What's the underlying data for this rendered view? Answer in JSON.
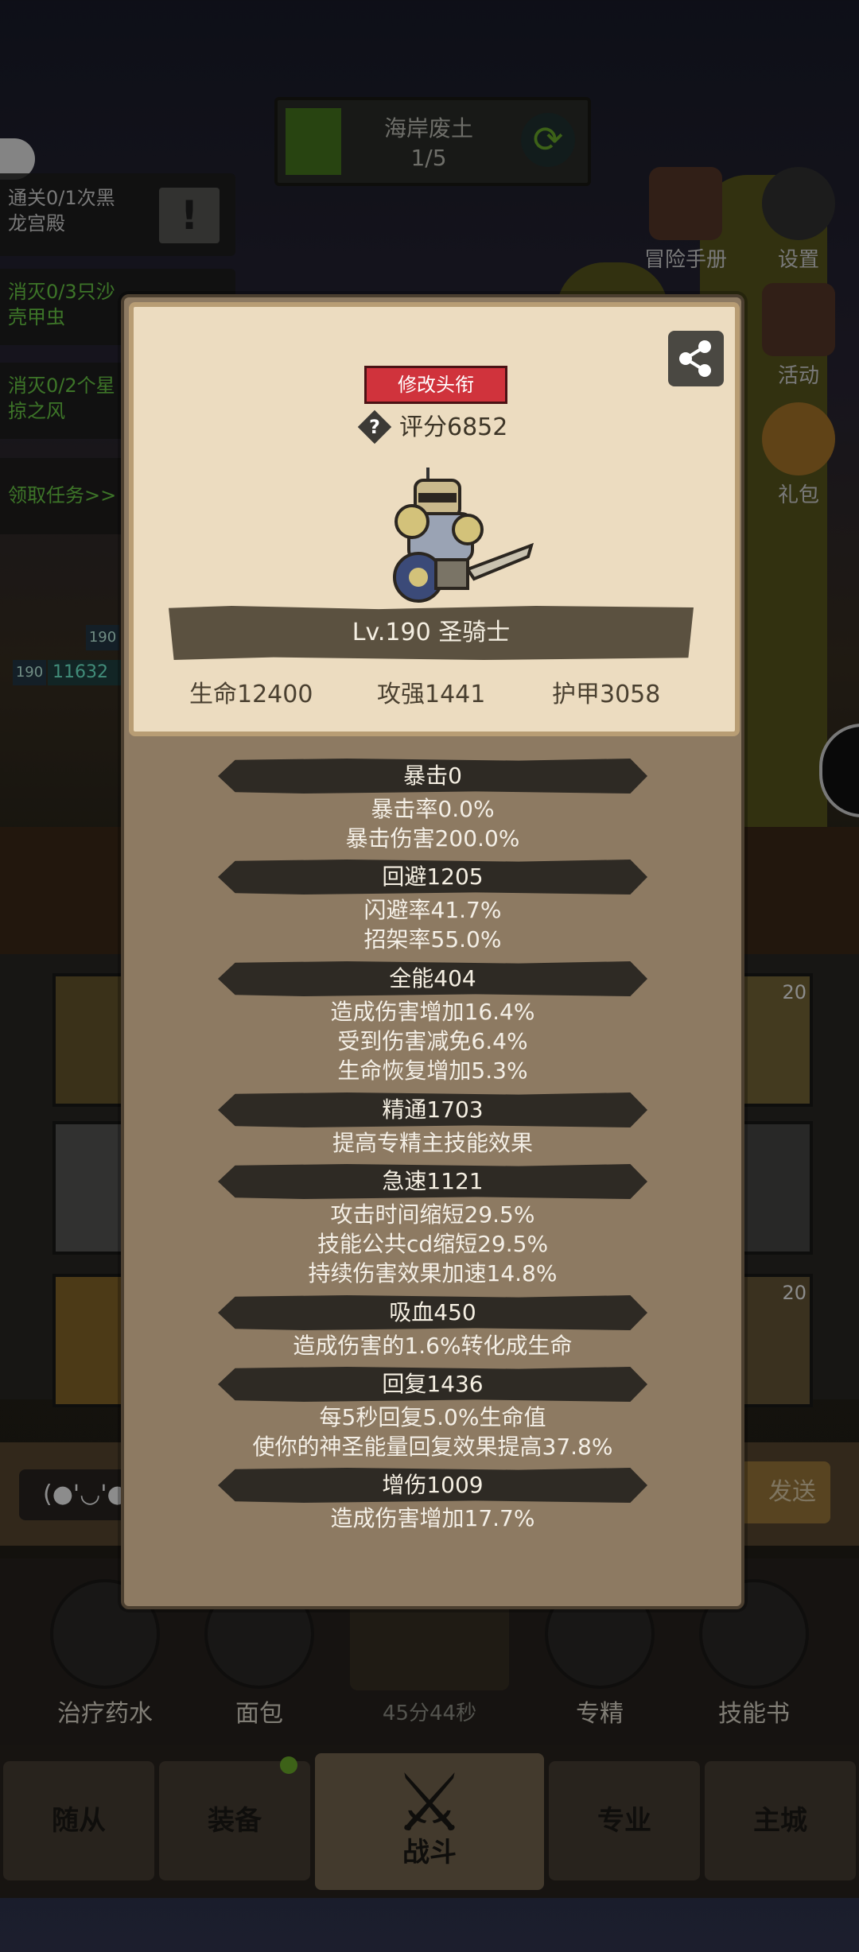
{
  "zone": {
    "title": "海岸废土",
    "progress": "1/5"
  },
  "quests": [
    {
      "line1": "通关0/1次黑",
      "line2": "龙宫殿",
      "color": "white"
    },
    {
      "line1": "消灭0/3只沙",
      "line2": "壳甲虫",
      "color": "green"
    },
    {
      "line1": "消灭0/2个星",
      "line2": "掠之风",
      "color": "green"
    },
    {
      "line1": "领取任务>>",
      "line2": "",
      "color": "green"
    }
  ],
  "side_menu": [
    {
      "label": "冒险手册",
      "icon": "book-icon"
    },
    {
      "label": "设置",
      "icon": "gear-icon"
    },
    {
      "label": "活动",
      "icon": "calendar-icon"
    },
    {
      "label": "礼包",
      "icon": "gift-icon"
    }
  ],
  "behind_fragments": {
    "level_badge_1": "190",
    "level_badge_2": "190",
    "hp_text": "11632",
    "slot_level_1": "20",
    "slot_level_2": "20",
    "chat_emote": "(●'◡'●",
    "send_partial": "发送"
  },
  "bottom_skills": [
    {
      "label": "治疗药水",
      "icon": "potion-icon"
    },
    {
      "label": "面包",
      "icon": "bread-icon"
    },
    {
      "label": "专精",
      "icon": "specialization-icon"
    },
    {
      "label": "技能书",
      "icon": "skillbook-icon"
    }
  ],
  "chest_timer": "45分44秒",
  "nav_tabs": [
    "随从",
    "装备",
    "战斗",
    "专业",
    "主城"
  ],
  "character": {
    "title_button": "修改头衔",
    "score_label": "评分6852",
    "name_label": "Lv.190 圣骑士",
    "base_stats": [
      "生命12400",
      "攻强1441",
      "护甲3058"
    ]
  },
  "stat_sections": [
    {
      "header": "暴击0",
      "lines": [
        "暴击率0.0%",
        "暴击伤害200.0%"
      ]
    },
    {
      "header": "回避1205",
      "lines": [
        "闪避率41.7%",
        "招架率55.0%"
      ]
    },
    {
      "header": "全能404",
      "lines": [
        "造成伤害增加16.4%",
        "受到伤害减免6.4%",
        "生命恢复增加5.3%"
      ]
    },
    {
      "header": "精通1703",
      "lines": [
        "提高专精主技能效果"
      ]
    },
    {
      "header": "急速1121",
      "lines": [
        "攻击时间缩短29.5%",
        "技能公共cd缩短29.5%",
        "持续伤害效果加速14.8%"
      ]
    },
    {
      "header": "吸血450",
      "lines": [
        "造成伤害的1.6%转化成生命"
      ]
    },
    {
      "header": "回复1436",
      "lines": [
        "每5秒回复5.0%生命值",
        "使你的神圣能量回复效果提高37.8%"
      ]
    },
    {
      "header": "增伤1009",
      "lines": [
        "造成伤害增加17.7%"
      ]
    }
  ],
  "colors": {
    "modal_bg": "#8d7a62",
    "card_bg": "#ecdcc0",
    "title_red": "#d0333c",
    "quest_green": "#6fd64a"
  }
}
